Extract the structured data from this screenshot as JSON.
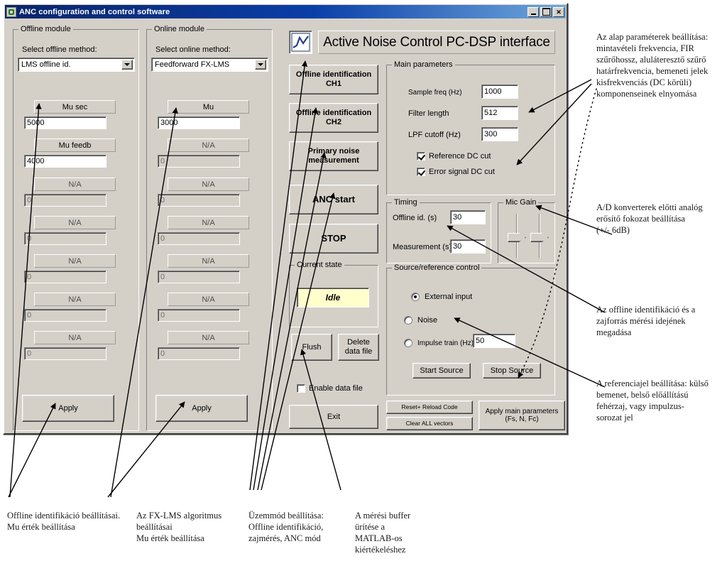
{
  "window": {
    "title": "ANC configuration and control software",
    "icon": "app-waveform-icon",
    "buttons": {
      "minimize": "_",
      "maximize": "□",
      "close": "✕"
    }
  },
  "banner": {
    "icon": "plot-waveform-icon",
    "text": "Active Noise Control PC-DSP interface"
  },
  "offline_module": {
    "legend": "Offline module",
    "method_label": "Select offline method:",
    "method_value": "LMS offline id.",
    "rows": [
      {
        "label": "Mu sec",
        "value": "5000",
        "enabled": true
      },
      {
        "label": "Mu feedb",
        "value": "4000",
        "enabled": true
      },
      {
        "label": "N/A",
        "value": "0",
        "enabled": false
      },
      {
        "label": "N/A",
        "value": "0",
        "enabled": false
      },
      {
        "label": "N/A",
        "value": "0",
        "enabled": false
      },
      {
        "label": "N/A",
        "value": "0",
        "enabled": false
      },
      {
        "label": "N/A",
        "value": "0",
        "enabled": false
      }
    ],
    "apply_label": "Apply"
  },
  "online_module": {
    "legend": "Online module",
    "method_label": "Select online method:",
    "method_value": "Feedforward FX-LMS",
    "rows": [
      {
        "label": "Mu",
        "value": "3000",
        "enabled": true
      },
      {
        "label": "N/A",
        "value": "0",
        "enabled": false
      },
      {
        "label": "N/A",
        "value": "0",
        "enabled": false
      },
      {
        "label": "N/A",
        "value": "0",
        "enabled": false
      },
      {
        "label": "N/A",
        "value": "0",
        "enabled": false
      },
      {
        "label": "N/A",
        "value": "0",
        "enabled": false
      },
      {
        "label": "N/A",
        "value": "0",
        "enabled": false
      }
    ],
    "apply_label": "Apply"
  },
  "actions": {
    "offline_id_ch1": "Offline identification\nCH1",
    "offline_id_ch2": "Offline identification\nCH2",
    "primary_noise": "Primary noise\nmeasurement",
    "anc_start": "ANC start",
    "stop": "STOP",
    "flush": "Flush",
    "delete_data_file": "Delete\ndata file",
    "enable_data_file": "Enable data file",
    "exit": "Exit",
    "reset_reload": "Reset+ Reload Code",
    "clear_all_vectors": "Clear ALL vectors",
    "apply_main_params": "Apply main parameters\n(Fs, N, Fc)"
  },
  "current_state": {
    "legend": "Current state",
    "value": "Idle"
  },
  "main_parameters": {
    "legend": "Main parameters",
    "fields": [
      {
        "label": "Sample freq (Hz)",
        "value": "1000"
      },
      {
        "label": "Filter length",
        "value": "512"
      },
      {
        "label": "LPF cutoff (Hz)",
        "value": "300"
      }
    ],
    "checkboxes": [
      {
        "label": "Reference DC cut",
        "checked": true
      },
      {
        "label": "Error signal DC cut",
        "checked": true
      }
    ]
  },
  "timing": {
    "legend": "Timing",
    "fields": [
      {
        "label": "Offline id. (s)",
        "value": "30"
      },
      {
        "label": "Measurement (s)",
        "value": "30"
      }
    ]
  },
  "mic_gain": {
    "legend": "Mic Gain",
    "sliders": [
      {
        "name": "mic-gain-slider-1"
      },
      {
        "name": "mic-gain-slider-2"
      }
    ]
  },
  "source_control": {
    "legend": "Source/reference control",
    "options": [
      {
        "label": "External input",
        "selected": true
      },
      {
        "label": "Noise",
        "selected": false
      },
      {
        "label": "Impulse train (Hz)",
        "selected": false
      }
    ],
    "impulse_value": "50",
    "start_label": "Start Source",
    "stop_label": "Stop Source"
  },
  "annotations": [
    {
      "id": "note-main-params",
      "text": "Az alap paraméterek beállítása:\nmintavételi frekvencia, FIR\nszűrőhossz, aluláteresztő szűrő\nhatárfrekvencia, bemeneti jelek\nkisfrekvenciás (DC körüli)\nkomponenseinek elnyomása"
    },
    {
      "id": "note-mic-gain",
      "text": "A/D konverterek előtti analóg\nerősítő fokozat beállítása\n(+/- 6dB)"
    },
    {
      "id": "note-timing",
      "text": "Az offline identifikáció és a\nzajforrás mérési idejének\nmegadása"
    },
    {
      "id": "note-source",
      "text": "A referenciajel beállítása: külső\nbemenet, belső előállítású\nfehérzaj, vagy impulzus-\nsorozat jel"
    },
    {
      "id": "note-offline",
      "text": "Offline identifikáció beállításai.\nMu érték beállítása"
    },
    {
      "id": "note-fxlms",
      "text": "Az FX-LMS algoritmus\nbeállításai\nMu érték beállítása"
    },
    {
      "id": "note-mode",
      "text": "Üzemmód beállítása:\nOffline identifikáció,\nzajmérés, ANC mód"
    },
    {
      "id": "note-buffer",
      "text": "A mérési buffer\nürítése a\nMATLAB-os\nkiértékeléshez"
    }
  ],
  "colors": {
    "face": "#d4d0c8",
    "title_start": "#0a246a",
    "title_end": "#6fa8dc",
    "status_bg": "#ffffcc",
    "field_bg": "#ffffff"
  }
}
